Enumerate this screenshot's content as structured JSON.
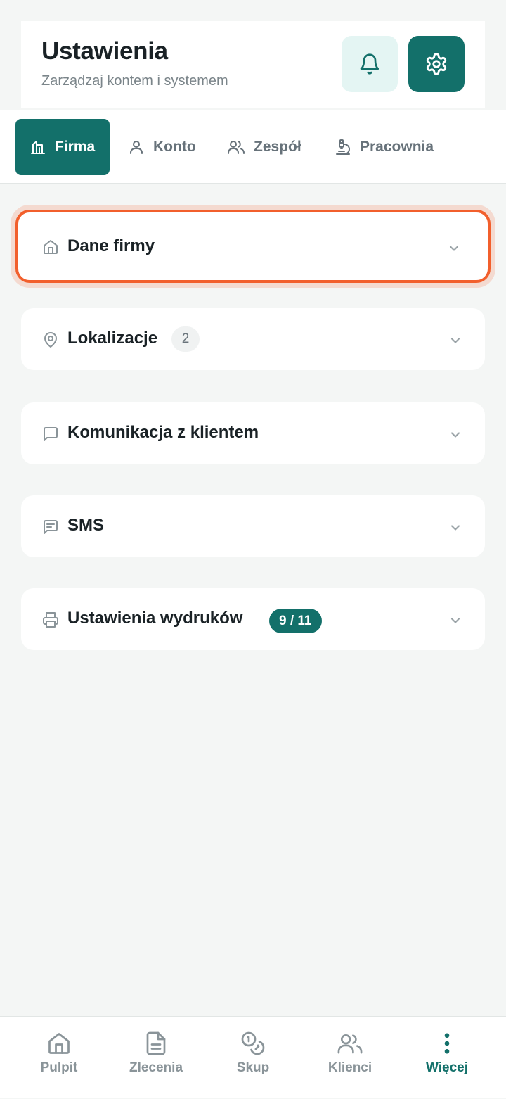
{
  "header": {
    "title": "Ustawienia",
    "subtitle": "Zarządzaj kontem i systemem",
    "bell_icon": "bell-icon",
    "gear_icon": "gear-icon"
  },
  "tabs": [
    {
      "label": "Firma",
      "icon": "building-icon",
      "active": true
    },
    {
      "label": "Konto",
      "icon": "user-icon",
      "active": false
    },
    {
      "label": "Zespół",
      "icon": "users-icon",
      "active": false
    },
    {
      "label": "Pracownia",
      "icon": "microscope-icon",
      "active": false
    }
  ],
  "sections": [
    {
      "title": "Dane firmy",
      "icon": "home-icon",
      "expanded": false
    },
    {
      "title": "Lokalizacje",
      "icon": "map-pin-icon",
      "badge": "2",
      "expanded": false
    },
    {
      "title": "Komunikacja z klientem",
      "icon": "message-square-icon",
      "expanded": false
    },
    {
      "title": "SMS",
      "icon": "message-lines-icon",
      "expanded": false
    },
    {
      "title": "Ustawienia wydruków",
      "icon": "printer-icon",
      "badge": "9 / 11",
      "expanded": false
    }
  ],
  "bottom_nav": [
    {
      "label": "Pulpit",
      "icon": "home-icon",
      "active": false
    },
    {
      "label": "Zlecenia",
      "icon": "document-icon",
      "active": false
    },
    {
      "label": "Skup",
      "icon": "coins-icon",
      "active": false
    },
    {
      "label": "Klienci",
      "icon": "users-icon",
      "active": false
    },
    {
      "label": "Więcej",
      "icon": "more-vertical-icon",
      "active": true
    }
  ],
  "colors": {
    "primary": "#13706a",
    "primary_light": "#e4f5f3",
    "focus_outline": "#f25f2c",
    "background": "#f4f6f5",
    "text_muted": "#7b858a"
  }
}
